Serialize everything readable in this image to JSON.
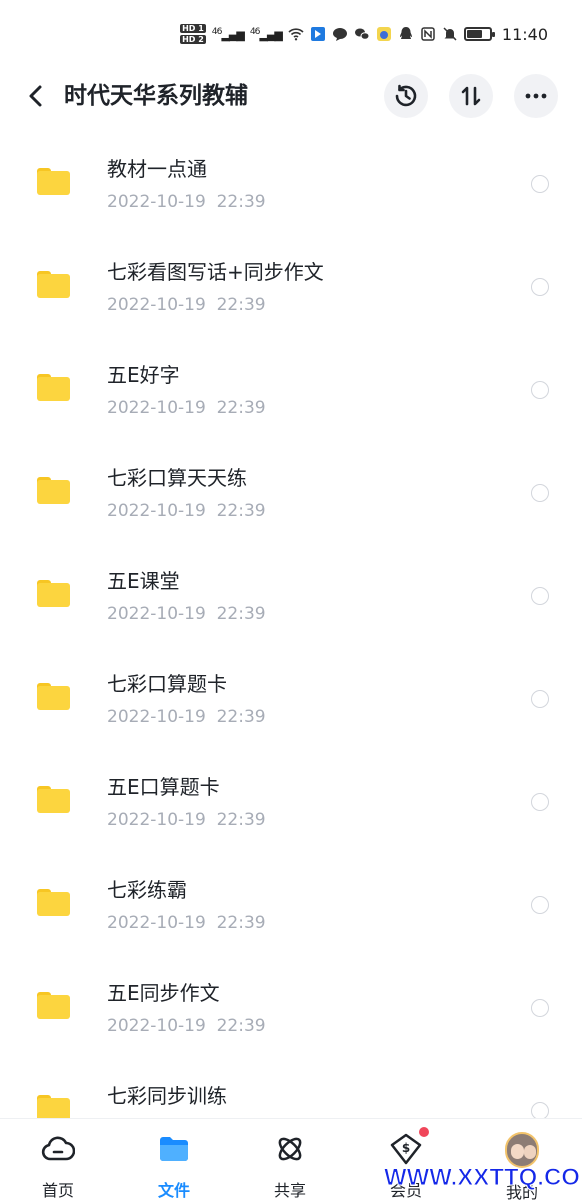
{
  "status_bar": {
    "hd1": "HD 1",
    "hd2": "HD 2",
    "net1": "46",
    "net2": "46",
    "time": "11:40",
    "battery_level": 0.7
  },
  "header": {
    "title": "时代天华系列教辅"
  },
  "files": [
    {
      "name": "教材一点通",
      "date": "2022-10-19  22:39"
    },
    {
      "name": "七彩看图写话+同步作文",
      "date": "2022-10-19  22:39"
    },
    {
      "name": "五E好字",
      "date": "2022-10-19  22:39"
    },
    {
      "name": "七彩口算天天练",
      "date": "2022-10-19  22:39"
    },
    {
      "name": "五E课堂",
      "date": "2022-10-19  22:39"
    },
    {
      "name": "七彩口算题卡",
      "date": "2022-10-19  22:39"
    },
    {
      "name": "五E口算题卡",
      "date": "2022-10-19  22:39"
    },
    {
      "name": "七彩练霸",
      "date": "2022-10-19  22:39"
    },
    {
      "name": "五E同步作文",
      "date": "2022-10-19  22:39"
    },
    {
      "name": "七彩同步训练",
      "date": ""
    }
  ],
  "tabbar": {
    "items": [
      {
        "label": "首页",
        "icon": "cloud-icon"
      },
      {
        "label": "文件",
        "icon": "folder-icon"
      },
      {
        "label": "共享",
        "icon": "atom-icon"
      },
      {
        "label": "会员",
        "icon": "dollar-badge-icon"
      },
      {
        "label": "我的",
        "icon": "avatar"
      }
    ]
  },
  "watermark": "WWW.XXTTQ.COM",
  "colors": {
    "accent": "#1a8cff",
    "folder": "#fcd53f",
    "date_text": "#a7acb6",
    "badge": "#f0465a"
  }
}
